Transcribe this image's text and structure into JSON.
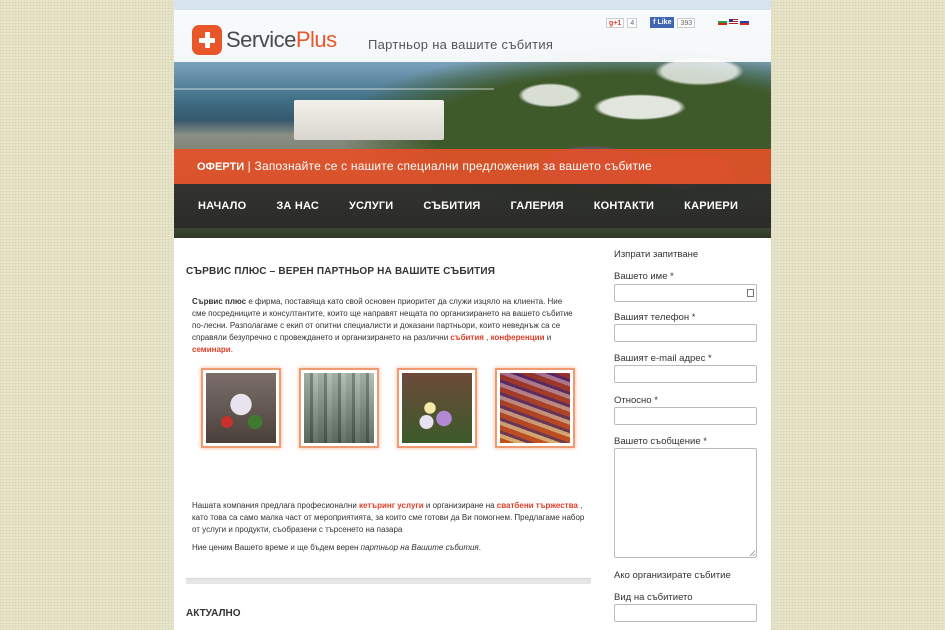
{
  "brand": {
    "logo_text_a": "Service",
    "logo_text_b": "Plus",
    "tagline": "Партньор на вашите събития"
  },
  "social": {
    "gplus_label": "g+1",
    "gplus_count": "4",
    "fb_label": "Like",
    "fb_count": "393"
  },
  "offer": {
    "bold": "ОФЕРТИ",
    "text": " | Запознайте се с нашите специални предложения за вашето събитие"
  },
  "nav": {
    "items": [
      {
        "label": "НАЧАЛО"
      },
      {
        "label": "ЗА НАС"
      },
      {
        "label": "УСЛУГИ"
      },
      {
        "label": "СЪБИТИЯ"
      },
      {
        "label": "ГАЛЕРИЯ"
      },
      {
        "label": "КОНТАКТИ"
      },
      {
        "label": "КАРИЕРИ"
      }
    ]
  },
  "main": {
    "heading": "СЪРВИС ПЛЮС – ВЕРЕН ПАРТНЬОР НА ВАШИТЕ СЪБИТИЯ",
    "intro_bold": "Сървис плюс",
    "intro_text": " е фирма, поставяща като свой основен приоритет да служи изцяло на клиента. Ние сме посредниците и консултантите, които ще направят нещата по организирането на вашето събитие по-лесни. Разполагаме с екип от опитни специалисти и доказани партньори, които неведнъж са се справяли безупречно с провеждането и организирането на различни ",
    "intro_link1": "събития",
    "intro_sep": " , ",
    "intro_link2": "конференции",
    "intro_and": " и ",
    "intro_link3": "семинари",
    "intro_end": ".",
    "para2_a": "Нашата компания предлага професионални ",
    "para2_link1": "кетъринг услуги",
    "para2_b": " и организиране на ",
    "para2_link2": "сватбени тържества",
    "para2_c": " , като това са само малка част от мероприятията, за които сме готови да Ви помогнем. Предлагаме набор от услуги и продукти, съобразени с търсенето на пазара",
    "para3_a": "Ние ценим Вашето време и ще бъдем верен ",
    "para3_i": "партньор на Вашите събития",
    "para3_end": ".",
    "heading2": "АКТУАЛНО"
  },
  "sidebar": {
    "title": "Изпрати запитване",
    "name_label": "Вашето име *",
    "phone_label": "Вашият телефон *",
    "email_label": "Вашият e-mail адрес *",
    "subject_label": "Относно *",
    "message_label": "Вашето съобщение *",
    "event_section": "Ако организирате събитие",
    "event_type_label": "Вид на събитието"
  }
}
